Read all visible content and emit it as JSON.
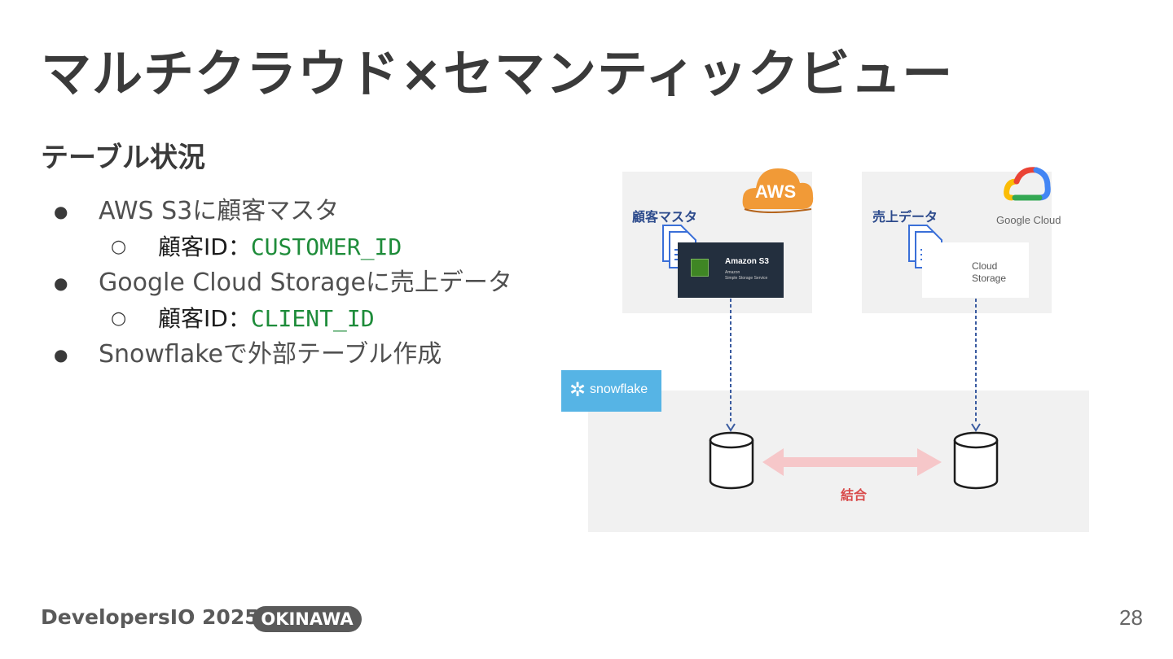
{
  "slide": {
    "title": "マルチクラウド×セマンティックビュー",
    "subtitle": "テーブル状況",
    "bullets": {
      "b1": {
        "marker": "●",
        "text": "AWS S3に顧客マスタ"
      },
      "b1_sub": {
        "marker": "○",
        "label": "顧客ID：",
        "code": "CUSTOMER_ID"
      },
      "b2": {
        "marker": "●",
        "text": "Google Cloud Storageに売上データ"
      },
      "b2_sub": {
        "marker": "○",
        "label": "顧客ID：",
        "code": "CLIENT_ID"
      },
      "b3": {
        "marker": "●",
        "text": "Snowflakeで外部テーブル作成"
      }
    },
    "page_number": "28"
  },
  "diagram": {
    "aws_badge": "AWS",
    "aws_panel_label": "顧客マスタ",
    "s3": {
      "name": "Amazon S3",
      "sub1": "Amazon",
      "sub2": "Simple Storage Service"
    },
    "gcp_panel_label": "売上データ",
    "google_cloud_label": "Google Cloud",
    "gcs": {
      "line1": "Cloud",
      "line2": "Storage"
    },
    "snowflake_badge": "snowflake",
    "snowflake_star": "✲",
    "join_label": "結合",
    "colors": {
      "panel": "#f1f1f1",
      "aws_orange": "#f19a37",
      "s3_dark": "#232f3e",
      "snowflake_blue": "#56b4e5",
      "arrow_blue": "#3a5ba0",
      "join_pink": "#f6c7c9",
      "join_text": "#d84a4a",
      "code_green": "#1e8c3a"
    },
    "icons": [
      "aws-cloud-icon",
      "document-icon",
      "s3-bucket-icon",
      "google-cloud-icon",
      "cloud-storage-icon",
      "snowflake-icon",
      "database-icon",
      "double-arrow-icon"
    ]
  },
  "footer": {
    "brand": "DevelopersIO 2025",
    "event_badge": "OKINAWA"
  }
}
